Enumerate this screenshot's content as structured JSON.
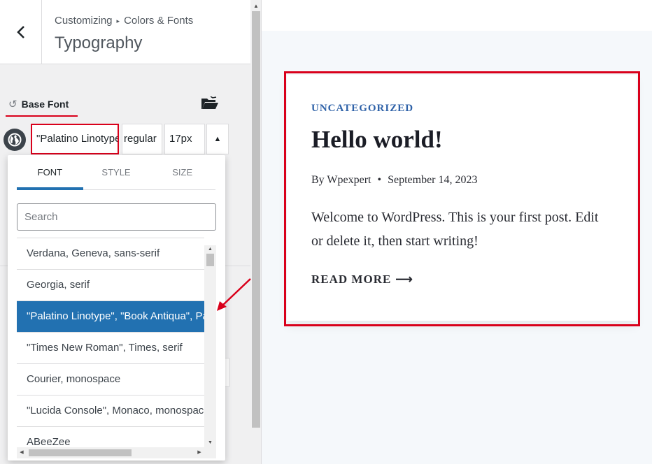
{
  "sidebar": {
    "breadcrumb": {
      "root": "Customizing",
      "separator": "▸",
      "section": "Colors & Fonts"
    },
    "title": "Typography",
    "base_font": {
      "label": "Base Font",
      "reset_icon": "↺",
      "family": "\"Palatino Linotype\"",
      "weight": "regular",
      "size": "17px",
      "collapse_icon": "▲"
    }
  },
  "dropdown": {
    "tabs": [
      {
        "label": "FONT"
      },
      {
        "label": "STYLE"
      },
      {
        "label": "SIZE"
      }
    ],
    "search_placeholder": "Search",
    "fonts": [
      {
        "label": "Verdana, Geneva, sans-serif"
      },
      {
        "label": "Georgia, serif"
      },
      {
        "label": "\"Palatino Linotype\", \"Book Antiqua\", Palatino, serif"
      },
      {
        "label": "\"Times New Roman\", Times, serif"
      },
      {
        "label": "Courier, monospace"
      },
      {
        "label": "\"Lucida Console\", Monaco, monospace"
      },
      {
        "label": "ABeeZee"
      }
    ]
  },
  "preview": {
    "category": "UNCATEGORIZED",
    "title": "Hello world!",
    "author": "By Wpexpert",
    "meta_separator": "•",
    "date": "September 14, 2023",
    "excerpt": "Welcome to WordPress. This is your first post. Edit or delete it, then start writing!",
    "read_more": "READ MORE",
    "read_more_arrow": "⟶"
  },
  "colors": {
    "accent": "#2271b1",
    "annotation": "#d9001b",
    "category_link": "#2f62a8"
  }
}
